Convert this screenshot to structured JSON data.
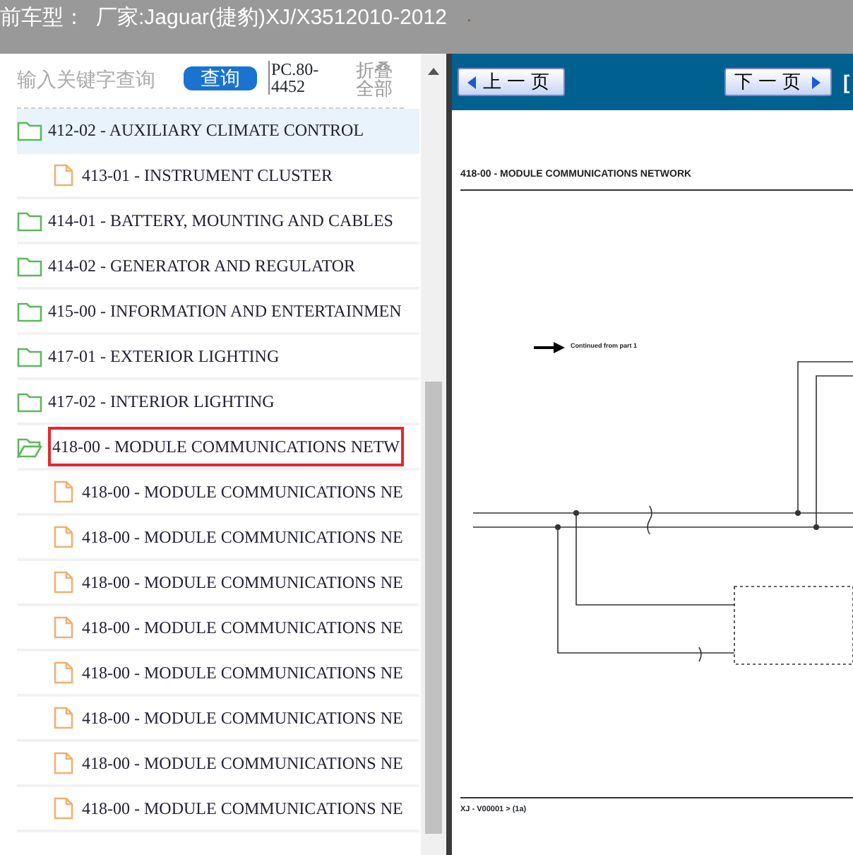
{
  "top_bar": {
    "vehicle_label": "前车型：",
    "vehicle": "厂家:Jaguar(捷豹)XJ/X3512010-2012",
    "marker": "."
  },
  "sidebar": {
    "search": {
      "placeholder": "输入关键字查询"
    },
    "search_button": "查询",
    "code": "PC.80-4452",
    "collapse_all": "折叠全部",
    "tree": [
      {
        "kind": "folder",
        "label": "412-02 - AUXILIARY CLIMATE CONTROL",
        "selected": true,
        "outlined": false,
        "children": [
          {
            "kind": "file",
            "label": "413-01 - INSTRUMENT CLUSTER",
            "selected": false,
            "outlined": false
          }
        ]
      },
      {
        "kind": "folder",
        "label": "414-01 - BATTERY, MOUNTING AND CABLES",
        "selected": false,
        "outlined": false
      },
      {
        "kind": "folder",
        "label": "414-02 - GENERATOR AND REGULATOR",
        "selected": false,
        "outlined": false
      },
      {
        "kind": "folder",
        "label": "415-00 - INFORMATION AND ENTERTAINMEN",
        "selected": false,
        "outlined": false
      },
      {
        "kind": "folder",
        "label": "417-01 - EXTERIOR LIGHTING",
        "selected": false,
        "outlined": false
      },
      {
        "kind": "folder",
        "label": "417-02 - INTERIOR LIGHTING",
        "selected": false,
        "outlined": false
      },
      {
        "kind": "open-folder",
        "label": "418-00 - MODULE COMMUNICATIONS NETW",
        "selected": false,
        "outlined": true,
        "children": [
          {
            "kind": "file",
            "label": "418-00 - MODULE COMMUNICATIONS NE",
            "selected": false,
            "outlined": false
          },
          {
            "kind": "file",
            "label": "418-00 - MODULE COMMUNICATIONS NE",
            "selected": false,
            "outlined": false
          },
          {
            "kind": "file",
            "label": "418-00 - MODULE COMMUNICATIONS NE",
            "selected": false,
            "outlined": false
          },
          {
            "kind": "file",
            "label": "418-00 - MODULE COMMUNICATIONS NE",
            "selected": false,
            "outlined": false
          },
          {
            "kind": "file",
            "label": "418-00 - MODULE COMMUNICATIONS NE",
            "selected": false,
            "outlined": false
          },
          {
            "kind": "file",
            "label": "418-00 - MODULE COMMUNICATIONS NE",
            "selected": false,
            "outlined": false
          },
          {
            "kind": "file",
            "label": "418-00 - MODULE COMMUNICATIONS NE",
            "selected": false,
            "outlined": false
          },
          {
            "kind": "file",
            "label": "418-00 - MODULE COMMUNICATIONS NE",
            "selected": false,
            "outlined": false
          }
        ]
      }
    ]
  },
  "viewer": {
    "prev_button": "上一页",
    "next_button": "下一页",
    "bracket": "[",
    "page": {
      "title": "418-00 - MODULE COMMUNICATIONS NETWORK",
      "arrow_note": "Continued from part 1",
      "footer": "XJ  - V00001 >  (1a)"
    }
  }
}
